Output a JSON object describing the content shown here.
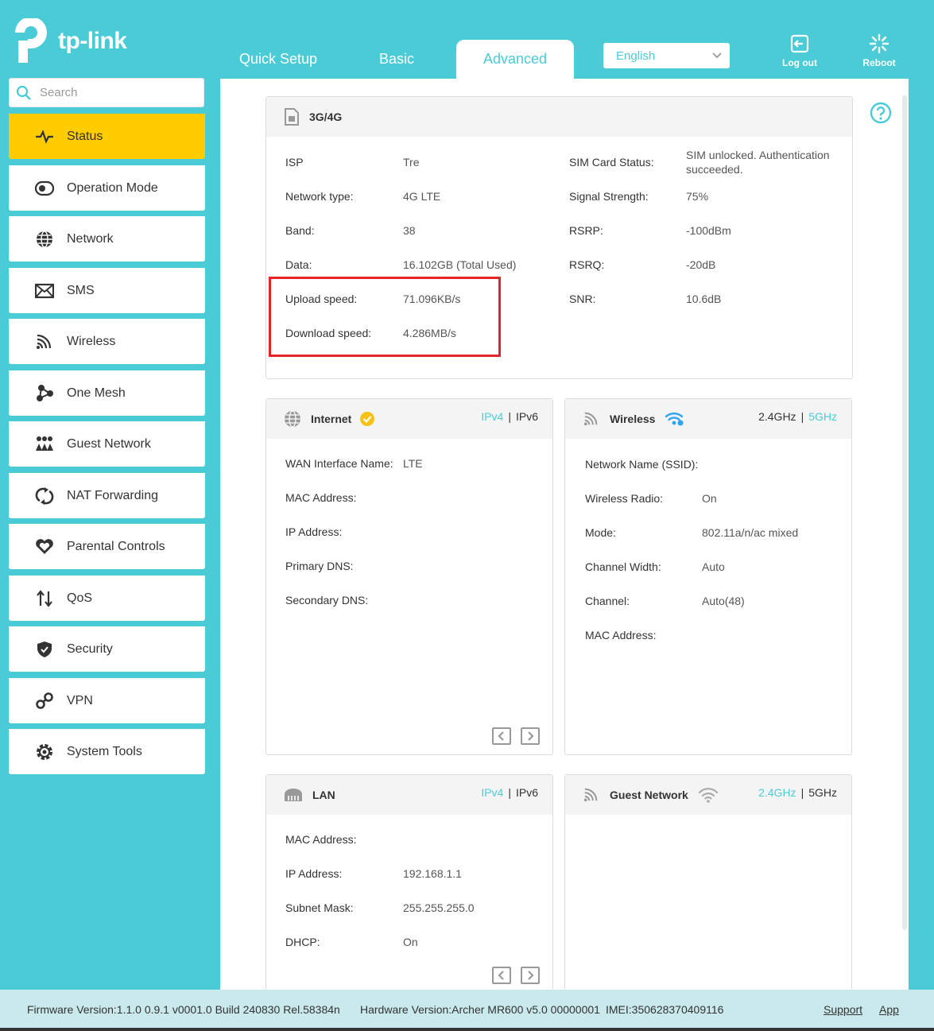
{
  "brand": {
    "name": "tp-link"
  },
  "tabs": [
    {
      "label": "Quick Setup"
    },
    {
      "label": "Basic"
    },
    {
      "label": "Advanced"
    }
  ],
  "language": {
    "selected": "English"
  },
  "header_buttons": {
    "logout": "Log out",
    "reboot": "Reboot"
  },
  "search": {
    "placeholder": "Search"
  },
  "sidebar": {
    "items": [
      {
        "label": "Status",
        "icon": "pulse-icon",
        "active": true
      },
      {
        "label": "Operation Mode",
        "icon": "toggle-icon"
      },
      {
        "label": "Network",
        "icon": "globe-icon"
      },
      {
        "label": "SMS",
        "icon": "envelope-icon"
      },
      {
        "label": "Wireless",
        "icon": "wifi-signal-icon"
      },
      {
        "label": "One Mesh",
        "icon": "mesh-icon"
      },
      {
        "label": "Guest Network",
        "icon": "guest-users-icon"
      },
      {
        "label": "NAT Forwarding",
        "icon": "nat-arrows-icon"
      },
      {
        "label": "Parental Controls",
        "icon": "heart-icon"
      },
      {
        "label": "QoS",
        "icon": "updown-arrows-icon"
      },
      {
        "label": "Security",
        "icon": "shield-icon"
      },
      {
        "label": "VPN",
        "icon": "key-link-icon"
      },
      {
        "label": "System Tools",
        "icon": "gear-icon"
      }
    ]
  },
  "cellular": {
    "title": "3G/4G",
    "left": [
      {
        "label": "ISP",
        "value": "Tre"
      },
      {
        "label": "Network type:",
        "value": "4G LTE"
      },
      {
        "label": "Band:",
        "value": "38"
      },
      {
        "label": "Data:",
        "value": "16.102GB (Total Used)"
      },
      {
        "label": "Upload speed:",
        "value": "71.096KB/s"
      },
      {
        "label": "Download speed:",
        "value": "4.286MB/s"
      }
    ],
    "right": [
      {
        "label": "SIM Card Status:",
        "value_line1": "SIM unlocked. Authentication",
        "value_line2": "succeeded."
      },
      {
        "label": "Signal Strength:",
        "value": "75%"
      },
      {
        "label": "RSRP:",
        "value": "-100dBm"
      },
      {
        "label": "RSRQ:",
        "value": "-20dB"
      },
      {
        "label": "SNR:",
        "value": "10.6dB"
      }
    ]
  },
  "internet": {
    "title": "Internet",
    "ip_tabs": [
      "IPv4",
      "IPv6"
    ],
    "rows": [
      {
        "label": "WAN Interface Name:",
        "value": "LTE"
      },
      {
        "label": "MAC Address:",
        "value": ""
      },
      {
        "label": "IP Address:",
        "value": ""
      },
      {
        "label": "Primary DNS:",
        "value": ""
      },
      {
        "label": "Secondary DNS:",
        "value": ""
      }
    ]
  },
  "wireless": {
    "title": "Wireless",
    "bands": [
      "2.4GHz",
      "5GHz"
    ],
    "rows": [
      {
        "label": "Network Name (SSID):",
        "value": ""
      },
      {
        "label": "Wireless Radio:",
        "value": "On"
      },
      {
        "label": "Mode:",
        "value": "802.11a/n/ac mixed"
      },
      {
        "label": "Channel Width:",
        "value": "Auto"
      },
      {
        "label": "Channel:",
        "value": "Auto(48)"
      },
      {
        "label": "MAC Address:",
        "value": ""
      }
    ]
  },
  "lan": {
    "title": "LAN",
    "ip_tabs": [
      "IPv4",
      "IPv6"
    ],
    "rows": [
      {
        "label": "MAC Address:",
        "value": ""
      },
      {
        "label": "IP Address:",
        "value": "192.168.1.1"
      },
      {
        "label": "Subnet Mask:",
        "value": "255.255.255.0"
      },
      {
        "label": "DHCP:",
        "value": "On"
      }
    ]
  },
  "guest": {
    "title": "Guest Network",
    "bands": [
      "2.4GHz",
      "5GHz"
    ]
  },
  "footer": {
    "firmware": "Firmware Version:1.1.0 0.9.1 v0001.0 Build 240830 Rel.58384n",
    "hardware": "Hardware Version:Archer MR600 v5.0 00000001",
    "imei": "IMEI:350628370409116",
    "support": "Support",
    "app": "App"
  },
  "colors": {
    "accent": "#4acbd6",
    "active_nav": "#ffcc00",
    "highlight_box": "#e3242b"
  }
}
